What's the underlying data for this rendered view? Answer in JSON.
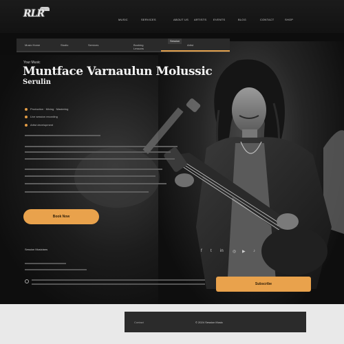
{
  "header": {
    "logo_text": "RLR",
    "nav": [
      "MUSIC",
      "SERVICES",
      "ABOUT US",
      "ARTISTS",
      "EVENTS",
      "BLOG",
      "CONTACT",
      "SHOP"
    ]
  },
  "subnav": {
    "items": [
      "Music Home",
      "Studio",
      "Services",
      "Booking",
      "Session"
    ],
    "sub": [
      "Lessons",
      "Artist"
    ],
    "active": "Session"
  },
  "hero": {
    "eyebrow": "Your Music",
    "title": "Muntface Varnaulun Molussic",
    "subtitle": "Serulin",
    "features": [
      "Production · Mixing · Mastering",
      "Live session recording",
      "Artist development"
    ],
    "cta": "Book Now"
  },
  "info": {
    "label": "Session Musicians",
    "social": [
      "f",
      "t",
      "in",
      "◎",
      "▶",
      "♪"
    ]
  },
  "bottom": {
    "cta": "Subscribe"
  },
  "footer": {
    "left": "Contact",
    "mid": "© 2024 Session Music"
  },
  "colors": {
    "accent": "#e9a24c",
    "background": "#0d0d0d",
    "footer": "#2b2b2b"
  }
}
